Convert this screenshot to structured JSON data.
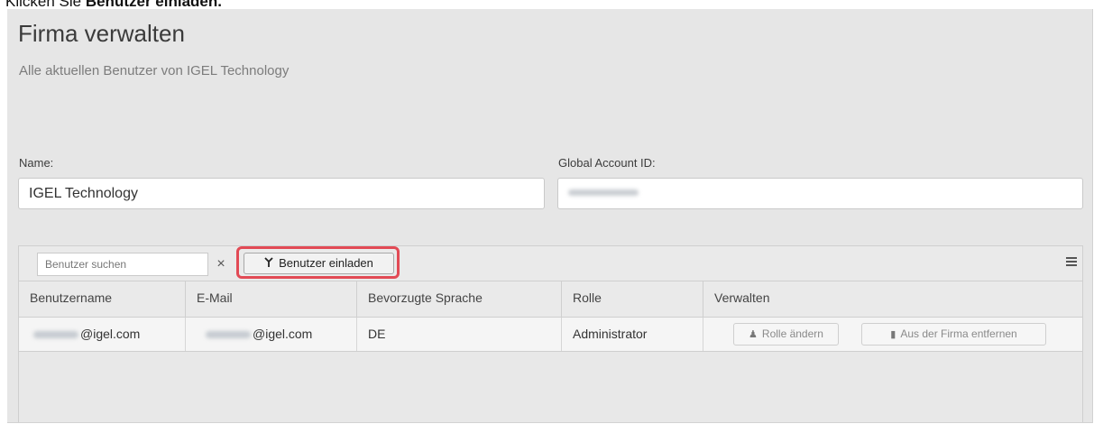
{
  "caption": {
    "prefix": "Klicken Sie ",
    "bold": "Benutzer einladen."
  },
  "page": {
    "title": "Firma verwalten",
    "subtitle": "Alle aktuellen Benutzer von IGEL Technology"
  },
  "form": {
    "name_label": "Name:",
    "name_value": "IGEL Technology",
    "account_label": "Global Account ID:"
  },
  "toolbar": {
    "search_placeholder": "Benutzer suchen",
    "clear_symbol": "×",
    "invite_icon": "invite-user-icon",
    "invite_label": "Benutzer einladen",
    "menu_icon": "hamburger-menu-icon"
  },
  "table": {
    "columns": [
      "Benutzername",
      "E-Mail",
      "Bevorzugte Sprache",
      "Rolle",
      "Verwalten"
    ],
    "rows": [
      {
        "username_suffix": "@igel.com",
        "email_suffix": "@igel.com",
        "language": "DE",
        "role": "Administrator",
        "change_role_label": "Rolle ändern",
        "remove_label": "Aus der Firma entfernen"
      }
    ]
  },
  "colors": {
    "highlight": "#e24a55",
    "panel_bg": "#e6e6e6"
  }
}
